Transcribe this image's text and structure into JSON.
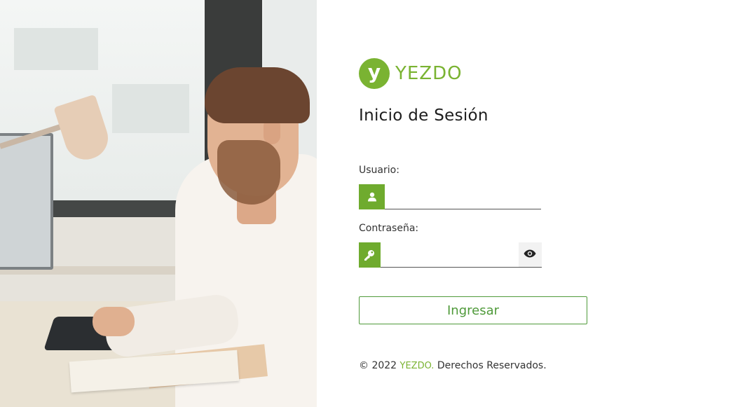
{
  "brand": {
    "logo_letter": "y",
    "name": "YEZDO",
    "color": "#7ab332"
  },
  "login": {
    "title": "Inicio de Sesión",
    "user_label": "Usuario:",
    "user_value": "",
    "user_icon": "user-icon",
    "password_label": "Contraseña:",
    "password_value": "",
    "password_icon": "key-icon",
    "toggle_icon": "eye-icon",
    "submit_label": "Ingresar",
    "accent_color": "#6fab2e",
    "button_color": "#4f9a3a"
  },
  "footer": {
    "prefix": "© 2022 ",
    "brand": "YEZDO.",
    "suffix": " Derechos Reservados."
  }
}
